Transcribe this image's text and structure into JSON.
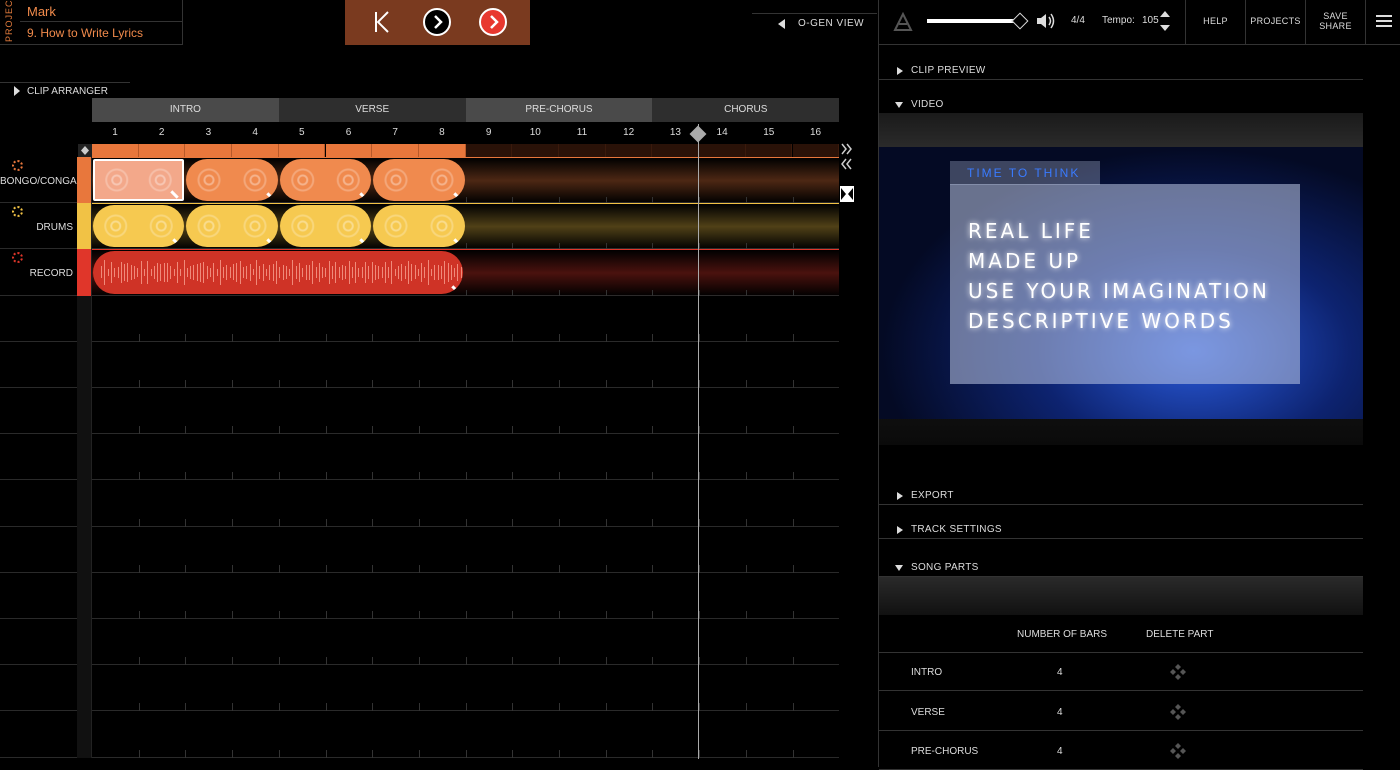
{
  "project": {
    "label": "PROJECT",
    "user": "Mark",
    "title": "9. How to Write Lyrics"
  },
  "transport": {
    "skip_back_icon": "skip-back-icon",
    "play_icon": "play-icon",
    "record_icon": "record-play-icon"
  },
  "ogen": {
    "label": "O-GEN VIEW"
  },
  "topbar": {
    "volume_level": 0.92,
    "time_signature": "4/4",
    "tempo_label": "Tempo:",
    "tempo_value": "105",
    "help": "HELP",
    "projects": "PROJECTS",
    "save_line1": "SAVE",
    "save_line2": "SHARE"
  },
  "arranger": {
    "label": "CLIP ARRANGER",
    "parts": [
      {
        "label": "INTRO",
        "color": "#4a4a4a"
      },
      {
        "label": "VERSE",
        "color": "#2e2e2e"
      },
      {
        "label": "PRE-CHORUS",
        "color": "#4a4a4a"
      },
      {
        "label": "CHORUS",
        "color": "#2e2e2e"
      }
    ],
    "bars": [
      "1",
      "2",
      "3",
      "4",
      "5",
      "6",
      "7",
      "8",
      "9",
      "10",
      "11",
      "12",
      "13",
      "14",
      "15",
      "16"
    ],
    "loop_bars": 8,
    "playhead_bar": 13.5,
    "tracks": [
      {
        "name": "BONGO/CONGA",
        "color": "#e8773c",
        "clip_color": "#f08a4e",
        "clips": 4
      },
      {
        "name": "DRUMS",
        "color": "#f1c245",
        "clip_color": "#f6c950",
        "clips": 4
      },
      {
        "name": "RECORD",
        "color": "#e0362a",
        "clip_color": "#cf3326",
        "clips": 1
      }
    ]
  },
  "panel": {
    "clip_preview": "CLIP PREVIEW",
    "video": "VIDEO",
    "video_tab": "TIME TO THINK",
    "video_lines": [
      "REAL LIFE",
      "MADE UP",
      "USE YOUR IMAGINATION",
      "DESCRIPTIVE WORDS"
    ],
    "export": "EXPORT",
    "track_settings": "TRACK SETTINGS",
    "song_parts": "SONG PARTS",
    "col_bars": "NUMBER OF BARS",
    "col_delete": "DELETE PART",
    "song_parts_rows": [
      {
        "name": "INTRO",
        "bars": "4"
      },
      {
        "name": "VERSE",
        "bars": "4"
      },
      {
        "name": "PRE-CHORUS",
        "bars": "4"
      }
    ]
  }
}
